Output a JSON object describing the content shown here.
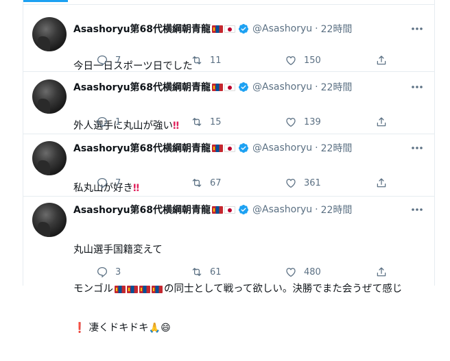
{
  "tweets": [
    {
      "name": "Asashoryu第68代横綱朝青龍",
      "handle": "@Asashoryu",
      "separator": "·",
      "time": "22時間",
      "lines": [
        "今日一日スポーツ日でした"
      ],
      "replies": "7",
      "retweets": "11",
      "likes": "150"
    },
    {
      "name": "Asashoryu第68代横綱朝青龍",
      "handle": "@Asashoryu",
      "separator": "·",
      "time": "22時間",
      "lines": [
        "外人選手に丸山が強い"
      ],
      "emphasis": "‼",
      "replies": "1",
      "retweets": "15",
      "likes": "139"
    },
    {
      "name": "Asashoryu第68代横綱朝青龍",
      "handle": "@Asashoryu",
      "separator": "·",
      "time": "22時間",
      "lines": [
        "私丸山が好き"
      ],
      "emphasis": "‼",
      "replies": "7",
      "retweets": "67",
      "likes": "361"
    },
    {
      "name": "Asashoryu第68代横綱朝青龍",
      "handle": "@Asashoryu",
      "separator": "·",
      "time": "22時間",
      "lines": [
        "丸山選手国籍変えて",
        "の同士として戦って欲しい。決勝でまた会うぜて感じ",
        "凄くドキドキ"
      ],
      "line2_prefix": "モンゴル",
      "line3_prefix": "❗",
      "line3_suffix": "🙏😄",
      "replies": "3",
      "retweets": "61",
      "likes": "480"
    }
  ],
  "colors": {
    "accent": "#1da1f2",
    "muted": "#5b7083",
    "border": "#e6ecf0",
    "emphasis": "#e0245e"
  }
}
